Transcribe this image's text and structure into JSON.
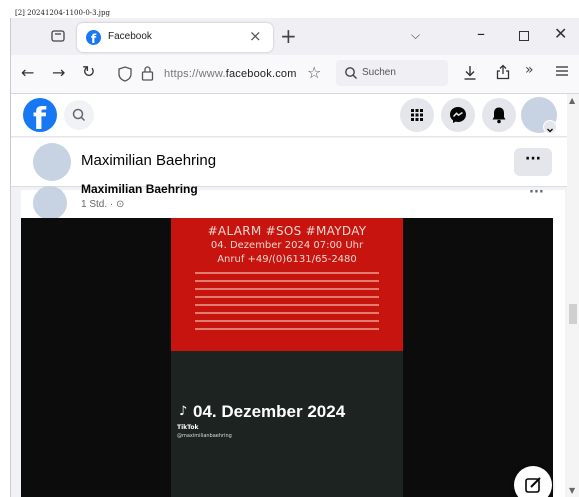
{
  "file_label": "[2] 20241204-1100-0-3.jpg",
  "browser": {
    "tab": {
      "title": "Facebook",
      "close": "×"
    },
    "new_tab": "+",
    "tab_list_chevron": "⌵",
    "window": {
      "minimize": "–",
      "close": "✕"
    },
    "nav": {
      "back": "←",
      "forward": "→",
      "reload": "↻",
      "star": "☆",
      "more": "»"
    },
    "url": {
      "prefix": "https://www.",
      "domain": "facebook.com"
    },
    "search_placeholder": "Suchen"
  },
  "facebook": {
    "profile_name": "Maximilian Baehring",
    "more_label": "···",
    "post": {
      "author": "Maximilian Baehring",
      "meta": "1 Std. · ⊙",
      "more": "···",
      "media": {
        "alarm_title": "#ALARM #SOS #MAYDAY",
        "alarm_date": "04. Dezember 2024 07:00 Uhr",
        "alarm_call": "Anruf +49/(0)6131/65-2480",
        "video_date": "04. Dezember 2024",
        "note_glyph": "♪",
        "tiktok_brand": "TikTok",
        "tiktok_user": "@maximilianbaehring"
      }
    }
  },
  "scrollbar": {
    "up": "▲",
    "down": "▼"
  },
  "colors": {
    "facebook_blue": "#1877f2",
    "alarm_red": "#c8140f",
    "video_dark": "#1c2320"
  }
}
